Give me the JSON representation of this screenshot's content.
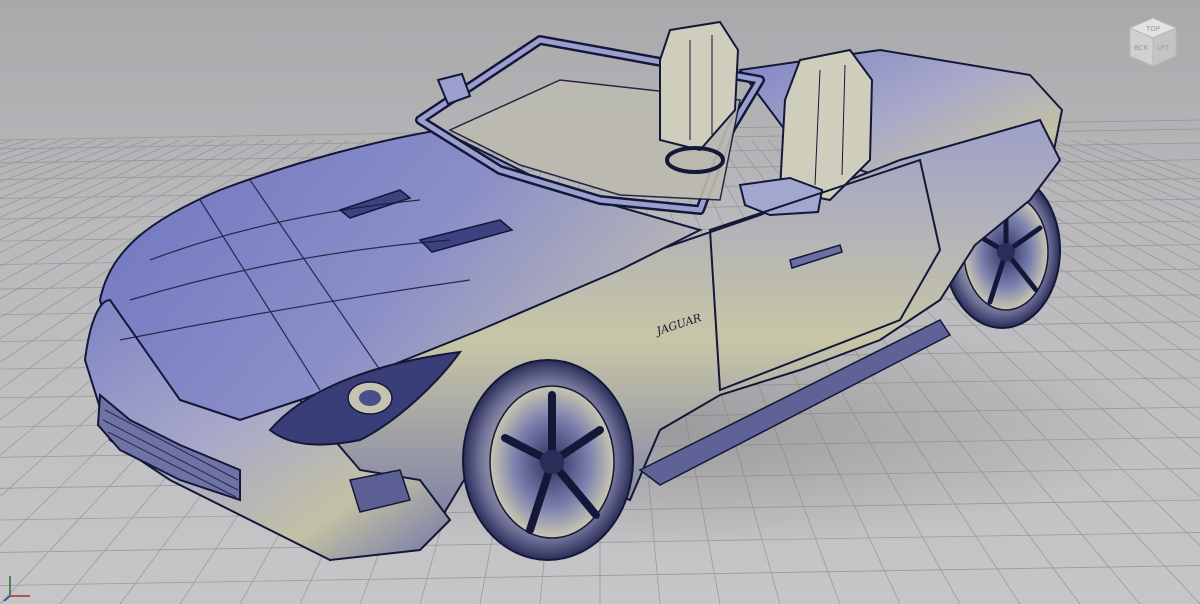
{
  "viewcube": {
    "front_label": "BCK",
    "side_label": "LFT",
    "top_label": "TOP"
  },
  "car": {
    "badge_text": "JAGUAR",
    "body_color": "#8c8fbf",
    "highlight_color": "#c8c6a8",
    "line_color": "#141838"
  },
  "icons": {
    "viewcube": "cube-icon",
    "axis_triad": "xyz-axis-icon"
  }
}
